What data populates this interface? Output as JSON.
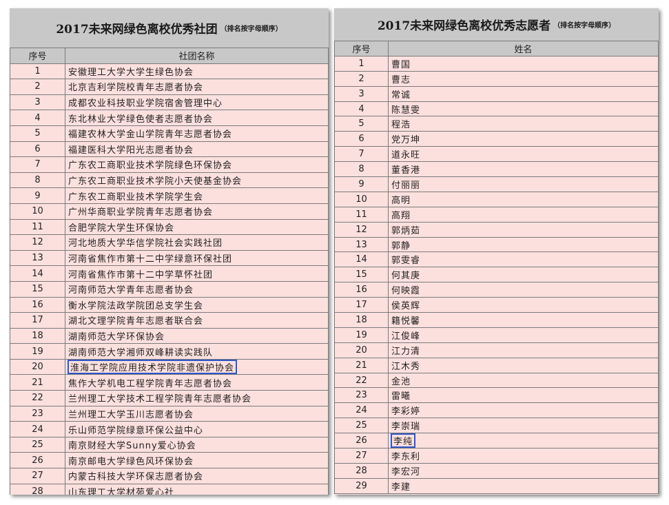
{
  "left": {
    "title": "2017未来网绿色离校优秀社团",
    "note": "（排名按字母顺序）",
    "headers": [
      "序号",
      "社团名称"
    ],
    "rows": [
      [
        "1",
        "安徽理工大学大学生绿色协会"
      ],
      [
        "2",
        "北京吉利学院校青年志愿者协会"
      ],
      [
        "3",
        "成都农业科技职业学院宿舍管理中心"
      ],
      [
        "4",
        "东北林业大学绿色使者志愿者协会"
      ],
      [
        "5",
        "福建农林大学金山学院青年志愿者协会"
      ],
      [
        "6",
        "福建医科大学阳光志愿者协会"
      ],
      [
        "7",
        "广东农工商职业技术学院绿色环保协会"
      ],
      [
        "8",
        "广东农工商职业技术学院小天使基金协会"
      ],
      [
        "9",
        "广东农工商职业技术学院学生会"
      ],
      [
        "10",
        "广州华商职业学院青年志愿者协会"
      ],
      [
        "11",
        "合肥学院大学生环保协会"
      ],
      [
        "12",
        "河北地质大学华信学院社会实践社团"
      ],
      [
        "13",
        "河南省焦作市第十二中学绿意环保社团"
      ],
      [
        "14",
        "河南省焦作市第十二中学草怀社团"
      ],
      [
        "15",
        "河南师范大学青年志愿者协会"
      ],
      [
        "16",
        "衡水学院法政学院团总支学生会"
      ],
      [
        "17",
        "湖北文理学院青年志愿者联合会"
      ],
      [
        "18",
        "湖南师范大学环保协会"
      ],
      [
        "19",
        "湖南师范大学湘师双峰耕读实践队"
      ],
      [
        "20",
        "淮海工学院应用技术学院非遗保护协会"
      ],
      [
        "21",
        "焦作大学机电工程学院青年志愿者协会"
      ],
      [
        "22",
        "兰州理工大学技术工程学院青年志愿者协会"
      ],
      [
        "23",
        "兰州理工大学玉川志愿者协会"
      ],
      [
        "24",
        "乐山师范学院绿意环保公益中心"
      ],
      [
        "25",
        "南京财经大学Sunny爱心协会"
      ],
      [
        "26",
        "南京邮电大学绿色风环保协会"
      ],
      [
        "27",
        "内蒙古科技大学环保志愿者协会"
      ],
      [
        "28",
        "山东理工大学材苑爱心社"
      ]
    ],
    "highlight_index": 19
  },
  "right": {
    "title": "2017未来网绿色离校优秀志愿者",
    "note": "（排名按字母顺序）",
    "headers": [
      "序号",
      "姓名"
    ],
    "rows": [
      [
        "1",
        "曹国"
      ],
      [
        "2",
        "曹志"
      ],
      [
        "3",
        "常诚"
      ],
      [
        "4",
        "陈慧雯"
      ],
      [
        "5",
        "程浩"
      ],
      [
        "6",
        "党万坤"
      ],
      [
        "7",
        "道永旺"
      ],
      [
        "8",
        "董香港"
      ],
      [
        "9",
        "付丽丽"
      ],
      [
        "10",
        "高明"
      ],
      [
        "11",
        "高翔"
      ],
      [
        "12",
        "郭炳茹"
      ],
      [
        "13",
        "郭静"
      ],
      [
        "14",
        "郭雯睿"
      ],
      [
        "15",
        "何其庚"
      ],
      [
        "16",
        "何映霞"
      ],
      [
        "17",
        "侯英辉"
      ],
      [
        "18",
        "籍悦馨"
      ],
      [
        "19",
        "江俊峰"
      ],
      [
        "20",
        "江力清"
      ],
      [
        "21",
        "江木秀"
      ],
      [
        "22",
        "金池"
      ],
      [
        "23",
        "雷曦"
      ],
      [
        "24",
        "李彩婷"
      ],
      [
        "25",
        "李崇瑞"
      ],
      [
        "26",
        "李纯"
      ],
      [
        "27",
        "李东利"
      ],
      [
        "28",
        "李宏河"
      ],
      [
        "29",
        "李建"
      ]
    ],
    "highlight_index": 25
  },
  "colors": {
    "panel_bg": "#fce0de",
    "header_bg": "#c8c8c8",
    "highlight": "#2e57c9"
  }
}
